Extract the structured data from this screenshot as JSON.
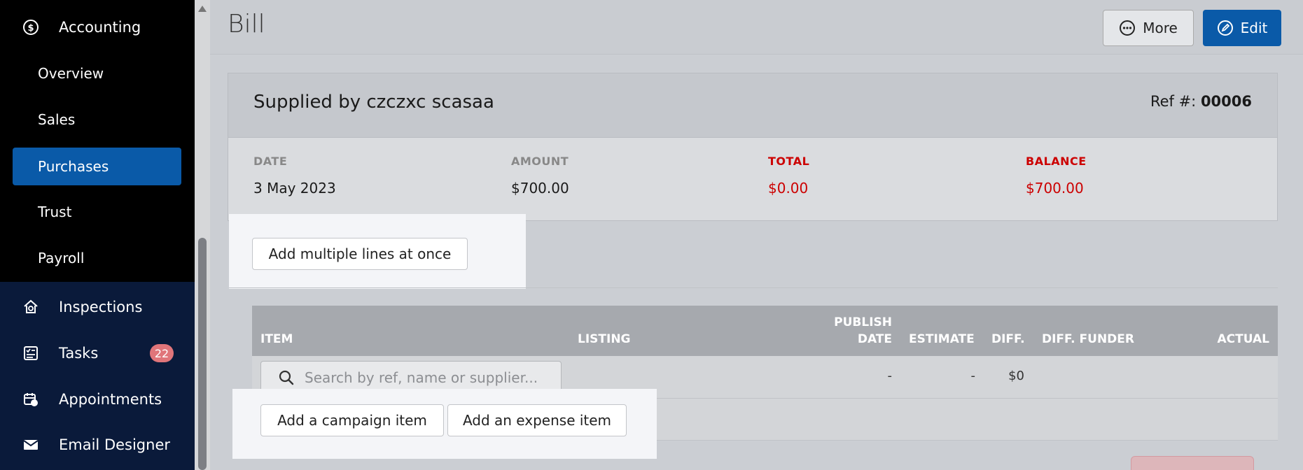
{
  "sidebar": {
    "accounting": "Accounting",
    "sub_items": [
      "Overview",
      "Sales",
      "Purchases",
      "Trust",
      "Payroll"
    ],
    "inspections": "Inspections",
    "tasks": "Tasks",
    "tasks_badge": "22",
    "appointments": "Appointments",
    "email_designer": "Email Designer"
  },
  "header": {
    "title": "Bill",
    "more_label": "More",
    "edit_label": "Edit"
  },
  "bill": {
    "supplied_by": "Supplied by czczxc scasaa",
    "ref_label": "Ref #:",
    "ref_value": "00006",
    "stats": [
      {
        "label": "DATE",
        "value": "3 May 2023"
      },
      {
        "label": "AMOUNT",
        "value": "$700.00"
      },
      {
        "label": "TOTAL",
        "value": "$0.00"
      },
      {
        "label": "BALANCE",
        "value": "$700.00"
      }
    ]
  },
  "actions": {
    "add_multiple": "Add multiple lines at once",
    "add_campaign": "Add a campaign item",
    "add_expense": "Add an expense item"
  },
  "table": {
    "columns": {
      "item": "ITEM",
      "listing": "LISTING",
      "publish_line1": "PUBLISH",
      "publish_line2": "DATE",
      "estimate": "ESTIMATE",
      "diff": "DIFF.",
      "diff_funder": "DIFF. FUNDER",
      "actual": "ACTUAL"
    },
    "row": {
      "search_placeholder": "Search by ref, name or supplier...",
      "publish_date": "-",
      "estimate": "-",
      "diff": "$0"
    }
  },
  "colors": {
    "primary": "#0a5aa8",
    "danger": "#cc0000",
    "sidebar_bg": "#000000",
    "sidebar_lower_bg": "#0a1a3a"
  }
}
